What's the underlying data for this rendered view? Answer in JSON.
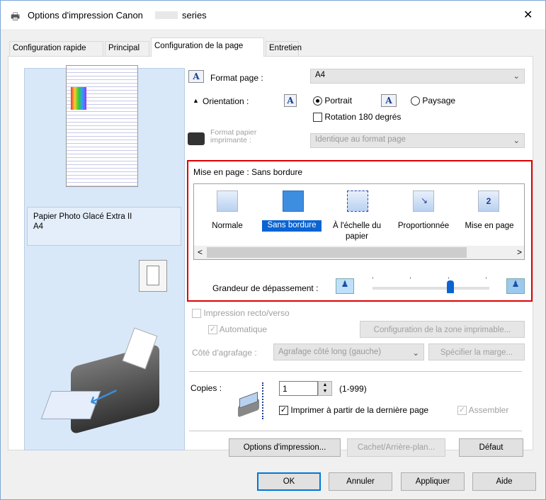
{
  "window": {
    "title": "Options d'impression Canon",
    "title_suffix": "series",
    "close": "✕"
  },
  "tabs": [
    {
      "label": "Configuration rapide"
    },
    {
      "label": "Principal"
    },
    {
      "label": "Configuration de la page"
    },
    {
      "label": "Entretien"
    }
  ],
  "preview": {
    "paper_name": "Papier Photo Glacé Extra II",
    "paper_size": "A4"
  },
  "page_size": {
    "label": "Format page :",
    "value": "A4"
  },
  "orientation": {
    "label": "Orientation :",
    "portrait": "Portrait",
    "landscape": "Paysage",
    "selected": "Portrait",
    "rotate_label": "Rotation 180 degrés",
    "rotate_checked": false,
    "icon_glyph": "A"
  },
  "printer_paper": {
    "label_line1": "Format papier",
    "label_line2": "imprimante :",
    "value": "Identique au format page"
  },
  "layout": {
    "label": "Mise en page :",
    "value": "Sans bordure",
    "items": [
      {
        "label": "Normale"
      },
      {
        "label": "Sans bordure"
      },
      {
        "label": "À l'échelle du",
        "label2": "papier"
      },
      {
        "label": "Proportionnée"
      },
      {
        "label": "Mise en page",
        "glyph": "2"
      }
    ],
    "scroll_left": "<",
    "scroll_right": ">"
  },
  "extension": {
    "label": "Grandeur de dépassement :",
    "level": 3,
    "levels": 4
  },
  "duplex": {
    "label": "Impression recto/verso",
    "checked": false,
    "auto_label": "Automatique",
    "auto_checked": true,
    "printable_area_button": "Configuration de la zone imprimable..."
  },
  "stapling": {
    "label": "Côté d'agrafage :",
    "value": "Agrafage côté long (gauche)",
    "margin_button": "Spécifier la marge..."
  },
  "copies": {
    "label": "Copies :",
    "value": "1",
    "range": "(1-999)",
    "reverse_label": "Imprimer à partir de la dernière page",
    "reverse_checked": true,
    "collate_label": "Assembler",
    "collate_checked": true
  },
  "buttons": {
    "print_options": "Options d'impression...",
    "stamp": "Cachet/Arrière-plan...",
    "defaults": "Défaut",
    "ok": "OK",
    "cancel": "Annuler",
    "apply": "Appliquer",
    "help": "Aide"
  },
  "colors": {
    "accent": "#0078d7",
    "highlight_box": "#e00000",
    "preview_bg": "#d8e8f8"
  }
}
